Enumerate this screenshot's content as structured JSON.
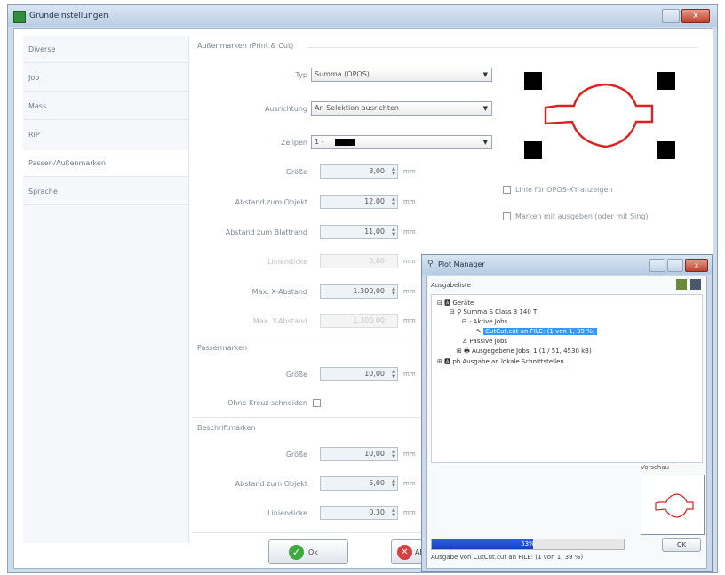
{
  "window": {
    "title": "Grundeinstellungen",
    "close_label": "x"
  },
  "sidebar": {
    "items": [
      {
        "label": "Diverse"
      },
      {
        "label": "Job"
      },
      {
        "label": "Mass"
      },
      {
        "label": "RIP"
      },
      {
        "label": "Passer-/Außenmarken"
      },
      {
        "label": "Sprache"
      }
    ],
    "active_index": 4
  },
  "aussenmarken": {
    "title": "Außenmarken (Print & Cut)",
    "typ": {
      "label": "Typ",
      "value": "Summa (OPOS)"
    },
    "ausrichtung": {
      "label": "Ausrichtung",
      "value": "An Selektion ausrichten"
    },
    "zeilpen": {
      "label": "Zeilpen",
      "value": "1 -"
    },
    "fields": [
      {
        "label": "Größe",
        "value": "3,00",
        "unit": "mm"
      },
      {
        "label": "Abstand zum Objekt",
        "value": "12,00",
        "unit": "mm"
      },
      {
        "label": "Abstand zum Blattrand",
        "value": "11,00",
        "unit": "mm"
      },
      {
        "label": "Liniendicke",
        "value": "0,00",
        "unit": "mm",
        "disabled": true
      },
      {
        "label": "Max. X-Abstand",
        "value": "1.300,00",
        "unit": "mm"
      },
      {
        "label": "Max. Y-Abstand",
        "value": "1.300,00",
        "unit": "mm",
        "disabled": true
      }
    ],
    "checkboxes": [
      {
        "label": "Linie für OPOS-XY anzeigen",
        "checked": false
      },
      {
        "label": "Marken mit ausgeben (oder mit Sing)",
        "checked": false
      }
    ]
  },
  "passermarken": {
    "title": "Passermarken",
    "groesse": {
      "label": "Größe",
      "value": "10,00",
      "unit": "mm"
    },
    "ohne_kreuz": {
      "label": "Ohne Kreuz schneiden",
      "checked": false
    }
  },
  "beschriftmarken": {
    "title": "Beschriftmarken",
    "fields": [
      {
        "label": "Größe",
        "value": "10,00",
        "unit": "mm"
      },
      {
        "label": "Abstand zum Objekt",
        "value": "5,00",
        "unit": "mm"
      },
      {
        "label": "Liniendicke",
        "value": "0,30",
        "unit": "mm"
      }
    ]
  },
  "buttons": {
    "ok": "Ok",
    "cancel": "Ab"
  },
  "plot_manager": {
    "title": "Plot Manager",
    "ausgabeliste": "Ausgabeliste",
    "tree": [
      {
        "label": "Geräte",
        "indent": 0,
        "icon": "device-icon"
      },
      {
        "label": "Summa S Class 3 140 T",
        "indent": 1,
        "icon": "plotter-icon"
      },
      {
        "label": "Aktive Jobs",
        "indent": 2,
        "icon": "folder-icon"
      },
      {
        "label": "CutCut.cut an FILE: (1 von 1, 39 %)",
        "indent": 3,
        "icon": "job-icon",
        "selected": true
      },
      {
        "label": "Passive Jobs",
        "indent": 2,
        "icon": "folder-icon"
      },
      {
        "label": "Ausgegebene Jobs: 1 (1 / 51, 4530 kB)",
        "indent": 2,
        "icon": "printer-icon"
      },
      {
        "label": "ph Ausgabe an lokale Schnittstellen",
        "indent": 0,
        "icon": "device-icon"
      }
    ],
    "vorschau_label": "Vorschau",
    "ok_button": "OK",
    "progress": {
      "percent": 53,
      "label": "53%"
    },
    "status": "Ausgabe von CutCut.cut an FILE: (1 von 1, 39 %)"
  }
}
